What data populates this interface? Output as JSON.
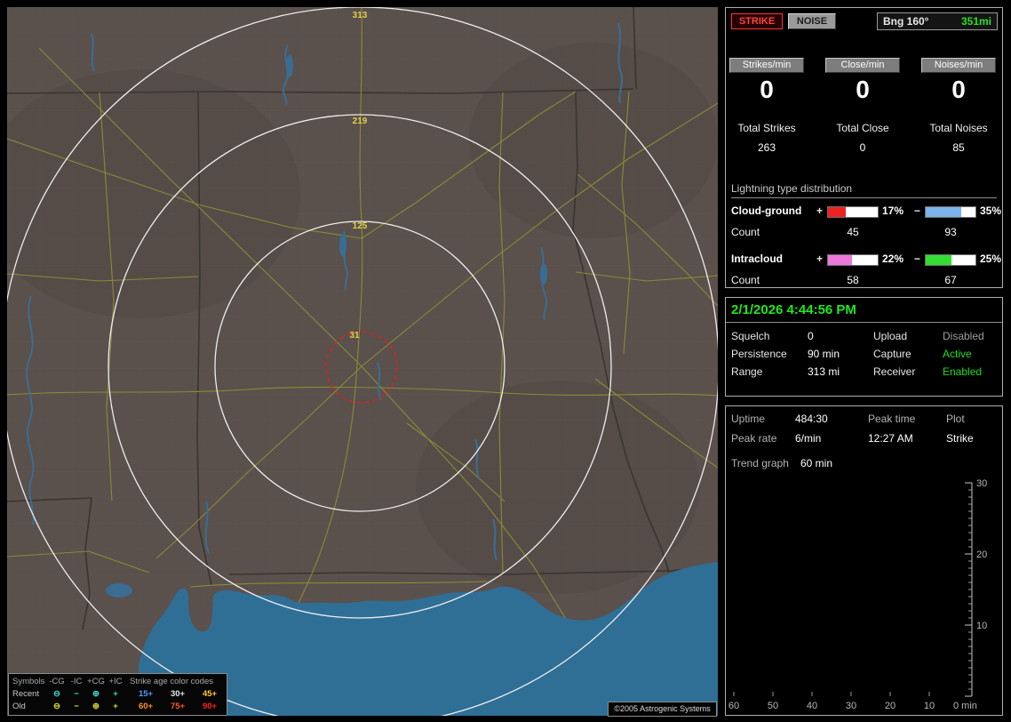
{
  "map": {
    "ring_labels": [
      "313",
      "219",
      "125",
      "31"
    ],
    "legend": {
      "symbols_header": "Symbols",
      "col_ncg": "-CG",
      "col_nic": "-IC",
      "col_pcg": "+CG",
      "col_pic": "+IC",
      "age_header": "Strike age color codes",
      "recent_label": "Recent",
      "old_label": "Old",
      "sym_circle_minus": "⊖",
      "sym_minus": "−",
      "sym_circle_plus": "⊕",
      "sym_plus": "+",
      "recent_color": "#3fd9c6",
      "old_color": "#e2de2e",
      "recent_ages": [
        {
          "t": "15+",
          "c": "#4f9bff"
        },
        {
          "t": "30+",
          "c": "#e8e8e8"
        },
        {
          "t": "45+",
          "c": "#ffc838"
        }
      ],
      "old_ages": [
        {
          "t": "60+",
          "c": "#ff9228"
        },
        {
          "t": "75+",
          "c": "#ff5526"
        },
        {
          "t": "90+",
          "c": "#ff1f1f"
        }
      ]
    },
    "copyright": "©2005 Astrogenic Systems"
  },
  "sidebar": {
    "strike_button": "STRIKE",
    "noise_button": "NOISE",
    "bearing_label": "Bng 160°",
    "bearing_range": "351mi",
    "bearing_range_color": "#2ae02a",
    "rate_boxes": [
      {
        "label": "Strikes/min",
        "value": "0"
      },
      {
        "label": "Close/min",
        "value": "0"
      },
      {
        "label": "Noises/min",
        "value": "0"
      }
    ],
    "totals": [
      {
        "label": "Total Strikes",
        "value": "263"
      },
      {
        "label": "Total Close",
        "value": "0"
      },
      {
        "label": "Total Noises",
        "value": "85"
      }
    ],
    "distribution": {
      "title": "Lightning type distribution",
      "plus_sign": "+",
      "minus_sign": "−",
      "count_label": "Count",
      "rows": [
        {
          "label": "Cloud-ground",
          "plus_pct": "17%",
          "minus_pct": "35%",
          "plus_color": "#ee2222",
          "minus_color": "#7ab4ea",
          "plus_fill": "36%",
          "minus_fill": "72%",
          "plus_count": "45",
          "minus_count": "93"
        },
        {
          "label": "Intracloud",
          "plus_pct": "22%",
          "minus_pct": "25%",
          "plus_color": "#ee77dd",
          "minus_color": "#33dd33",
          "plus_fill": "48%",
          "minus_fill": "52%",
          "plus_count": "58",
          "minus_count": "67"
        }
      ]
    },
    "status": {
      "datetime": "2/1/2026 4:44:56 PM",
      "rows": [
        {
          "l1": "Squelch",
          "v1": "0",
          "l2": "Upload",
          "v2": "Disabled",
          "v2_color": "#9f9f9f"
        },
        {
          "l1": "Persistence",
          "v1": "90 min",
          "l2": "Capture",
          "v2": "Active",
          "v2_color": "#22dd22"
        },
        {
          "l1": "Range",
          "v1": "313 mi",
          "l2": "Receiver",
          "v2": "Enabled",
          "v2_color": "#22dd22"
        }
      ]
    },
    "stats": {
      "uptime_label": "Uptime",
      "uptime": "484:30",
      "peak_time_label": "Peak time",
      "plot_label": "Plot",
      "peak_rate_label": "Peak rate",
      "peak_rate": "6/min",
      "peak_time": "12:27 AM",
      "plot_value": "Strike",
      "trend_label": "Trend graph",
      "trend_value": "60 min"
    },
    "trend_graph": {
      "y_ticks": [
        "30",
        "20",
        "10"
      ],
      "x_ticks": [
        "60",
        "50",
        "40",
        "30",
        "20",
        "10"
      ],
      "x_end": "0 min"
    }
  }
}
